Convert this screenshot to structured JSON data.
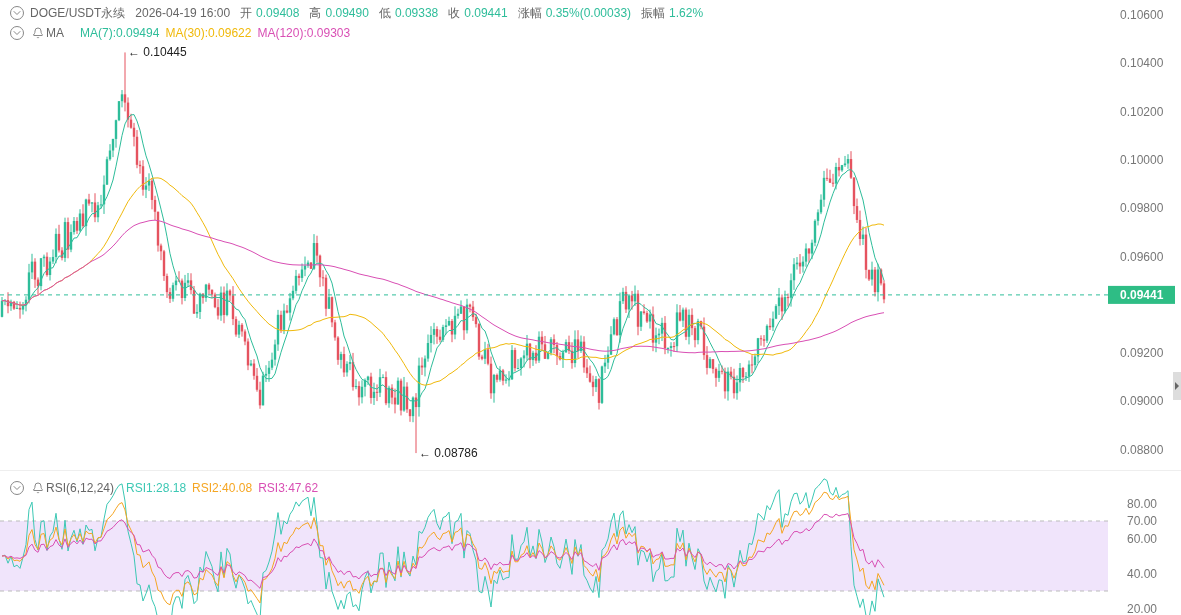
{
  "header": {
    "symbol": "DOGE/USDT永续",
    "time": "2026-04-19 16:00",
    "fields": [
      {
        "label": "开",
        "value": "0.09408"
      },
      {
        "label": "高",
        "value": "0.09490"
      },
      {
        "label": "低",
        "value": "0.09338"
      },
      {
        "label": "收",
        "value": "0.09441"
      },
      {
        "label": "涨幅",
        "value": "0.35%(0.00033)"
      },
      {
        "label": "振幅",
        "value": "1.62%"
      }
    ]
  },
  "ma_legend": {
    "name": "MA",
    "items": [
      {
        "text": "MA(7):0.09494",
        "color": "#2ebd9a"
      },
      {
        "text": "MA(30):0.09622",
        "color": "#f0b90b"
      },
      {
        "text": "MA(120):0.09303",
        "color": "#d94fb4"
      }
    ]
  },
  "price_chart": {
    "high_marker": "← 0.10445",
    "low_marker": "← 0.08786",
    "last_price": "0.09441",
    "axis_ticks": [
      "0.10600",
      "0.10400",
      "0.10200",
      "0.10000",
      "0.09800",
      "0.09600",
      "0.09200",
      "0.09000",
      "0.08800"
    ]
  },
  "rsi": {
    "name": "RSI(6,12,24)",
    "items": [
      {
        "text": "RSI1:28.18",
        "color": "#3cc8b4"
      },
      {
        "text": "RSI2:40.08",
        "color": "#f5a623"
      },
      {
        "text": "RSI3:47.62",
        "color": "#d94fb4"
      }
    ],
    "axis_ticks": [
      "80.00",
      "70.00",
      "60.00",
      "40.00",
      "20.00"
    ]
  }
}
